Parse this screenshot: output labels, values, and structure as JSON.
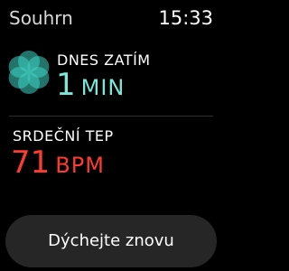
{
  "status_bar": {
    "app_title": "Souhrn",
    "time": "15:33"
  },
  "today": {
    "label": "DNES ZATÍM",
    "value": "1",
    "unit": "MIN",
    "icon": "breathe-flower-icon",
    "accent_color": "#7ce6d8"
  },
  "heart_rate": {
    "label": "SRDEČNÍ TEP",
    "value": "71",
    "unit": "BPM",
    "accent_color": "#ff3b30"
  },
  "action": {
    "label": "Dýchejte znovu"
  }
}
